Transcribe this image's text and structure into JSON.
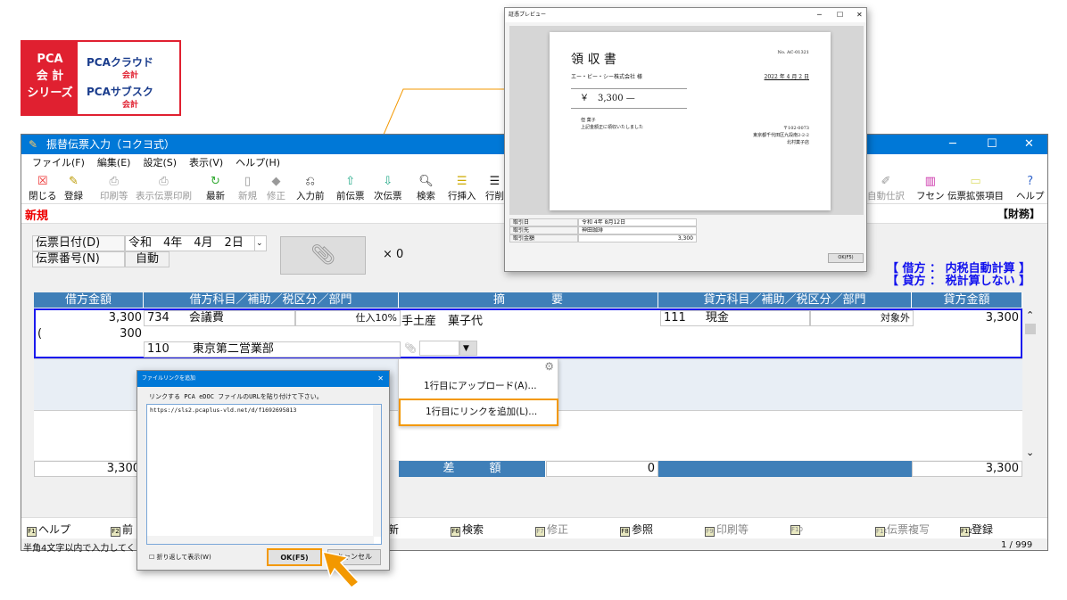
{
  "logo": {
    "series": [
      "PCA",
      "会 計",
      "シリーズ"
    ],
    "products": [
      {
        "name": "PCAクラウド",
        "sub": "会計"
      },
      {
        "name": "PCAサブスク",
        "sub": "会計"
      }
    ]
  },
  "window": {
    "title": "振替伝票入力（コクヨ式）",
    "menu": [
      "ファイル(F)",
      "編集(E)",
      "設定(S)",
      "表示(V)",
      "ヘルプ(H)"
    ],
    "toolbar": [
      {
        "label": "閉じる",
        "icon": "close-icon",
        "enabled": true
      },
      {
        "label": "登録",
        "icon": "register-icon",
        "enabled": true
      },
      {
        "label": "印刷等",
        "icon": "printer-icon",
        "enabled": false
      },
      {
        "label": "表示伝票印刷",
        "icon": "printer-icon",
        "enabled": false
      },
      {
        "label": "最新",
        "icon": "refresh-icon",
        "enabled": true
      },
      {
        "label": "新規",
        "icon": "new-icon",
        "enabled": false
      },
      {
        "label": "修正",
        "icon": "eraser-icon",
        "enabled": false
      },
      {
        "label": "入力前",
        "icon": "undo-doc-icon",
        "enabled": true
      },
      {
        "label": "前伝票",
        "icon": "prev-icon",
        "enabled": true
      },
      {
        "label": "次伝票",
        "icon": "next-icon",
        "enabled": true
      },
      {
        "label": "検索",
        "icon": "search-icon",
        "enabled": true
      },
      {
        "label": "行挿入",
        "icon": "insert-row-icon",
        "enabled": true
      },
      {
        "label": "行削",
        "icon": "delete-row-icon",
        "enabled": true
      },
      {
        "label": "自動仕訳",
        "icon": "auto-journal-icon",
        "enabled": false
      },
      {
        "label": "フセン",
        "icon": "sticky-icon",
        "enabled": true
      },
      {
        "label": "伝票拡張項目",
        "icon": "comment-icon",
        "enabled": true
      },
      {
        "label": "ヘルプ",
        "icon": "help-icon",
        "enabled": true
      }
    ],
    "mode": "新規",
    "category": "【財務】",
    "form": {
      "date_label": "伝票日付(D)",
      "date_value": "令和　4年　4月　2日",
      "number_label": "伝票番号(N)",
      "number_value": "自動",
      "attach_count": "× 0"
    },
    "tax_notes": [
      "【 借方 ： 内税自動計算 】",
      "【 貸方 ： 税計算しない 】"
    ],
    "grid": {
      "headers": [
        "借方金額",
        "借方科目／補助／税区分／部門",
        "摘　　　　要",
        "貸方科目／補助／税区分／部門",
        "貸方金額"
      ],
      "row": {
        "debit_amount": "3,300",
        "debit_tax_paren": "(",
        "debit_tax": "300",
        "debit_code": "734",
        "debit_account": "会議費",
        "debit_tax_class": "仕入10%",
        "dept_code": "110",
        "dept": "東京第二営業部",
        "memo": "手土産　菓子代",
        "credit_code": "111",
        "credit_account": "現金",
        "credit_tax_class": "対象外",
        "credit_amount": "3,300"
      },
      "totals": {
        "debit": "3,300",
        "diff_label": "差　　　額",
        "diff": "0",
        "credit": "3,300"
      }
    },
    "fkeys": [
      {
        "key": "F1",
        "label": "ヘルプ",
        "enabled": true
      },
      {
        "key": "F2",
        "label": "前",
        "enabled": true
      },
      {
        "key": "F3",
        "label": "新",
        "enabled": true
      },
      {
        "key": "F6",
        "label": "検索",
        "enabled": true
      },
      {
        "key": "F7",
        "label": "修正",
        "enabled": false
      },
      {
        "key": "F8",
        "label": "参照",
        "enabled": true
      },
      {
        "key": "F9",
        "label": "印刷等",
        "enabled": false
      },
      {
        "key": "F10",
        "label": "",
        "enabled": false
      },
      {
        "key": "F11",
        "label": "伝票複写",
        "enabled": false
      },
      {
        "key": "F12",
        "label": "登録",
        "enabled": true
      }
    ],
    "status": {
      "hint": "半角4文字以内で入力してく",
      "page": "1 / 999"
    }
  },
  "popup_menu": {
    "items": [
      "1行目にアップロード(A)...",
      "1行目にリンクを追加(L)..."
    ]
  },
  "preview": {
    "title": "証憑プレビュー",
    "doc_title": "領 収 書",
    "doc_no": "No. AC-01321",
    "addressee": "エー・ビー・シー株式会社 様",
    "date": "2022 年 4 月 2 日",
    "amount": "￥　3,300 —",
    "note1": "但 菓子",
    "note2": "上記金額正に領収いたしました",
    "zip": "〒102-0073",
    "address": "東京都千代田区九段南2-2-2",
    "shop": "北村菓子店",
    "fields": [
      {
        "label": "取引日",
        "value": "令和 4年 8月12日"
      },
      {
        "label": "取引先",
        "value": "神田珈琲"
      },
      {
        "label": "取引金額",
        "value": "3,300"
      }
    ],
    "ok": "OK(F5)"
  },
  "link_dialog": {
    "title": "ファイルリンクを追加",
    "prompt": "リンクする PCA eDOC ファイルのURLを貼り付けて下さい。",
    "url": "https://sls2.pcaplus-vld.net/d/f1692695813",
    "wrap_label": "折り返して表示(W)",
    "ok": "OK(F5)",
    "cancel": "キャンセル"
  },
  "colors": {
    "accent": "#f39800",
    "titlebar": "#0078d7",
    "grid_header": "#3f7fb8",
    "brand_red": "#e02030"
  }
}
